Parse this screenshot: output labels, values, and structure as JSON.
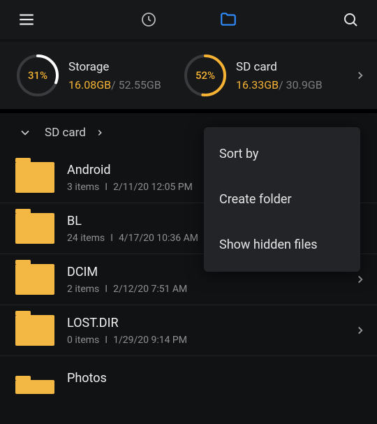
{
  "colors": {
    "accent": "#f5b233",
    "folder": "#f3b743",
    "muted": "#8f9194",
    "tab_active": "#2f8cff"
  },
  "storage": [
    {
      "label": "Storage",
      "percent": "31%",
      "pct_num": 31,
      "used": "16.08GB",
      "total": "52.55GB",
      "ring_stroke": "#ffffff"
    },
    {
      "label": "SD card",
      "percent": "52%",
      "pct_num": 52,
      "used": "16.33GB",
      "total": "30.9GB",
      "ring_stroke": "#f5b233"
    }
  ],
  "breadcrumb": {
    "label": "SD card"
  },
  "folders": [
    {
      "name": "Android",
      "items": "3 items",
      "date": "2/11/20 12:05 PM"
    },
    {
      "name": "BL",
      "items": "24 items",
      "date": "4/17/20 10:36 AM"
    },
    {
      "name": "DCIM",
      "items": "2 items",
      "date": "2/12/20 7:51 AM"
    },
    {
      "name": "LOST.DIR",
      "items": "0 items",
      "date": "1/29/20 9:14 PM"
    },
    {
      "name": "Photos",
      "items": "",
      "date": ""
    }
  ],
  "menu": {
    "sort": "Sort by",
    "create": "Create folder",
    "hidden": "Show hidden files"
  }
}
